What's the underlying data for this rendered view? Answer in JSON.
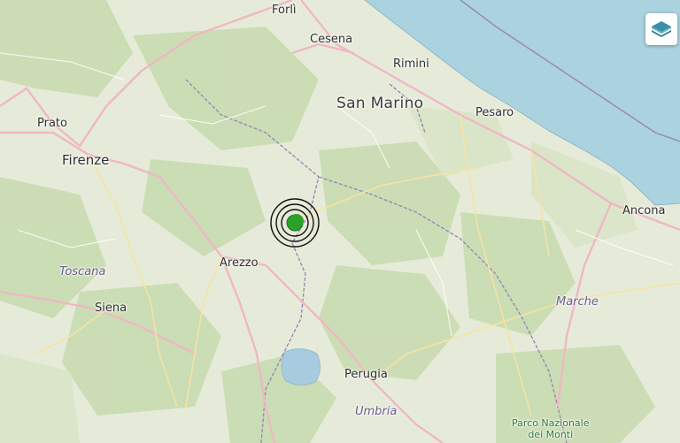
{
  "map": {
    "cities": {
      "forli": "Forlì",
      "cesena": "Cesena",
      "rimini": "Rimini",
      "pesaro": "Pesaro",
      "prato": "Prato",
      "firenze": "Firenze",
      "arezzo": "Arezzo",
      "siena": "Siena",
      "perugia": "Perugia",
      "ancona": "Ancona"
    },
    "state": {
      "san_marino": "San Marino"
    },
    "regions": {
      "toscana": "Toscana",
      "marche": "Marche",
      "umbria": "Umbria"
    },
    "park": {
      "line1": "Parco Nazionale",
      "line2": "dei Monti"
    },
    "colors": {
      "land": "#e6ebd9",
      "forest": "#c9dcb0",
      "sea": "#aad3df",
      "lake": "#a9cbe0",
      "road_major": "#f0b7c3",
      "road_secondary": "#f7e3a2",
      "border": "#9a88b6",
      "earthquake_marker": "#2aa22a"
    },
    "controls": {
      "layers_icon": "layers-icon"
    }
  }
}
